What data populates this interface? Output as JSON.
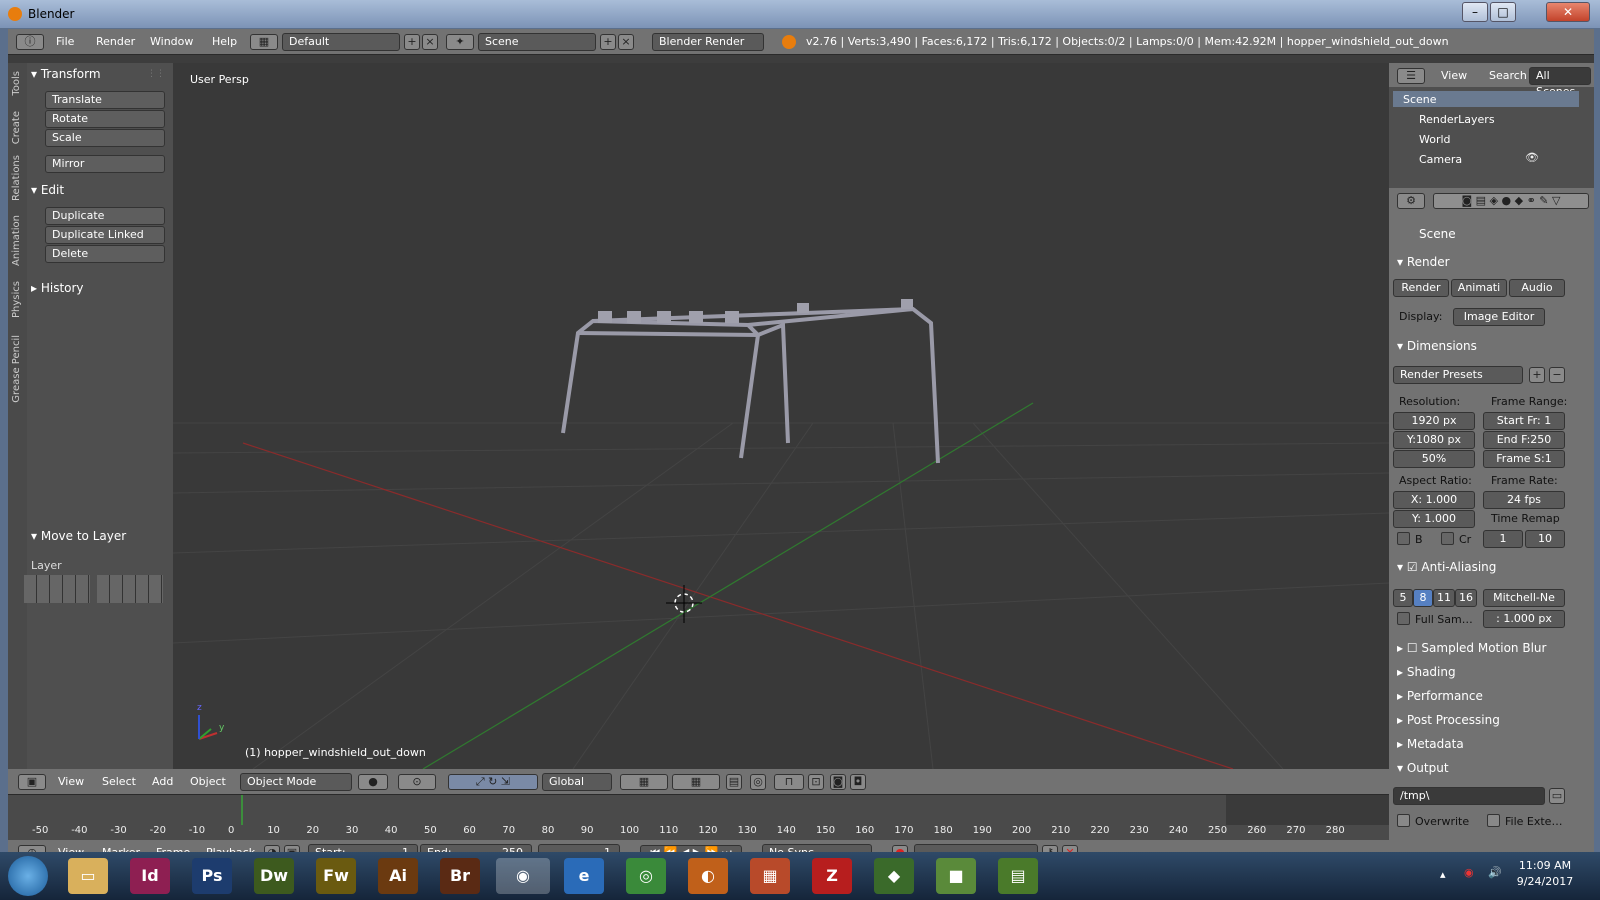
{
  "window": {
    "title": "Blender",
    "min": "–",
    "max": "□",
    "close": "✕"
  },
  "menu": {
    "items": [
      "File",
      "Render",
      "Window",
      "Help"
    ],
    "layout": "Default",
    "scene": "Scene",
    "engine": "Blender Render",
    "info": "v2.76 | Verts:3,490 | Faces:6,172 | Tris:6,172 | Objects:0/2 | Lamps:0/0 | Mem:42.92M | hopper_windshield_out_down"
  },
  "tool_tabs": [
    "Tools",
    "Create",
    "Relations",
    "Animation",
    "Physics",
    "Grease Pencil"
  ],
  "tools": {
    "transform_title": "Transform",
    "transform_buttons": [
      "Translate",
      "Rotate",
      "Scale",
      "Mirror"
    ],
    "edit_title": "Edit",
    "edit_buttons": [
      "Duplicate",
      "Duplicate Linked",
      "Delete"
    ],
    "history_title": "History",
    "move_to_layer": "Move to Layer",
    "layer_label": "Layer"
  },
  "viewport": {
    "persp_label": "User Persp",
    "object_label": "(1) hopper_windshield_out_down",
    "axis_x": "x",
    "axis_y": "y",
    "axis_z": "z",
    "grid_color": "#454545",
    "x_axis_color": "#8a2b2b",
    "y_axis_color": "#2f7a2f"
  },
  "view_header": {
    "items": [
      "View",
      "Select",
      "Add",
      "Object"
    ],
    "mode": "Object Mode",
    "orientation": "Global"
  },
  "outliner": {
    "tabs": [
      "View",
      "Search",
      "All Scenes"
    ],
    "rows": [
      "Scene",
      "RenderLayers",
      "World",
      "Camera"
    ]
  },
  "properties": {
    "scene": "Scene",
    "render_title": "Render",
    "render_buttons": [
      "Render",
      "Animati",
      "Audio"
    ],
    "display_label": "Display:",
    "display_value": "Image Editor",
    "dimensions_title": "Dimensions",
    "presets": "Render Presets",
    "resolution_label": "Resolution:",
    "frame_range_label": "Frame Range:",
    "res_x": "1920 px",
    "res_y": "Y:1080 px",
    "res_pct": "50%",
    "start": "Start Fr: 1",
    "end": "End F:250",
    "step": "Frame S:1",
    "aspect_label": "Aspect Ratio:",
    "framerate_label": "Frame Rate:",
    "aspect_x": "X: 1.000",
    "aspect_y": "Y: 1.000",
    "fps": "24 fps",
    "time_remap": "Time Remap",
    "b_label": "B",
    "cr_label": "Cr",
    "remap_old": "1",
    "remap_new": "10",
    "aa_title": "Anti-Aliasing",
    "aa_samples": [
      "5",
      "8",
      "11",
      "16"
    ],
    "aa_filter": "Mitchell-Ne",
    "full_sample": "Full Sam…",
    "filter_size": ": 1.000 px",
    "motion_blur": "Sampled Motion Blur",
    "shading": "Shading",
    "performance": "Performance",
    "post_processing": "Post Processing",
    "metadata": "Metadata",
    "output_title": "Output",
    "output_path": "/tmp\\",
    "overwrite": "Overwrite",
    "file_ext": "File Exte…"
  },
  "timeline": {
    "ticks": [
      "-50",
      "-40",
      "-30",
      "-20",
      "-10",
      "0",
      "10",
      "20",
      "30",
      "40",
      "50",
      "60",
      "70",
      "80",
      "90",
      "100",
      "110",
      "120",
      "130",
      "140",
      "150",
      "160",
      "170",
      "180",
      "190",
      "200",
      "210",
      "220",
      "230",
      "240",
      "250",
      "260",
      "270",
      "280"
    ],
    "menu": [
      "View",
      "Marker",
      "Frame",
      "Playback"
    ],
    "start": "Start:",
    "start_val": "1",
    "end": "End:",
    "end_val": "250",
    "current": "1",
    "sync": "No Sync"
  },
  "taskbar": {
    "apps": [
      "Id",
      "Ps",
      "Dw",
      "Fw",
      "Ai",
      "Br"
    ],
    "time": "11:09 AM",
    "date": "9/24/2017"
  }
}
